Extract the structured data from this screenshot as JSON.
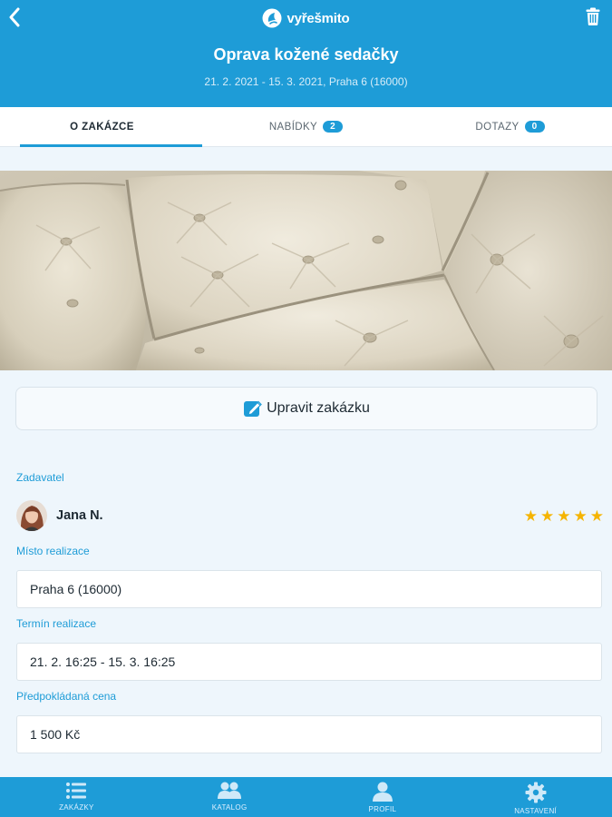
{
  "header": {
    "logo_text": "vyřešmito",
    "title": "Oprava kožené sedačky",
    "subtitle": "21. 2. 2021 - 15. 3. 2021, Praha 6 (16000)",
    "back_icon": "chevron-left-icon",
    "delete_icon": "trash-icon"
  },
  "tabs": [
    {
      "label": "O ZAKÁZCE",
      "active": true
    },
    {
      "label": "NABÍDKY",
      "badge": "2"
    },
    {
      "label": "DOTAZY",
      "badge": "0"
    }
  ],
  "edit_button": {
    "label": "Upravit zakázku",
    "icon": "edit-icon"
  },
  "client": {
    "section_label": "Zadavatel",
    "name": "Jana N.",
    "rating": 5,
    "stars": [
      "★",
      "★",
      "★",
      "★",
      "★"
    ]
  },
  "location": {
    "label": "Místo realizace",
    "value": "Praha 6 (16000)"
  },
  "term": {
    "label": "Termín realizace",
    "value": "21. 2. 16:25 - 15. 3. 16:25"
  },
  "price": {
    "label": "Předpokládaná cena",
    "value": "1 500 Kč"
  },
  "bottom_nav": [
    {
      "label": "ZAKÁZKY",
      "icon": "list-icon"
    },
    {
      "label": "KATALOG",
      "icon": "users-icon"
    },
    {
      "label": "PROFIL",
      "icon": "person-icon"
    },
    {
      "label": "NASTAVENÍ",
      "icon": "gear-icon"
    }
  ],
  "colors": {
    "primary": "#1e9cd7",
    "star": "#f5b400",
    "background": "#eef6fc"
  }
}
